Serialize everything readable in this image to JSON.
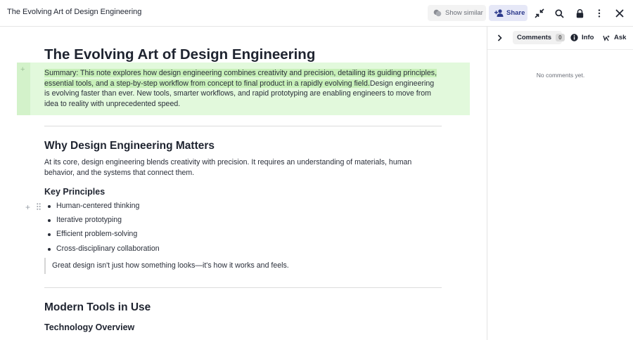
{
  "topbar": {
    "doc_title": "The Evolving Art of Design Engineering",
    "show_similar_label": "Show similar",
    "share_label": "Share"
  },
  "side_panel": {
    "comments_label": "Comments",
    "comments_count": "0",
    "info_label": "Info",
    "ask_label": "Ask",
    "empty_text": "No comments yet."
  },
  "document": {
    "title": "The Evolving Art of Design Engineering",
    "summary_highlighted": "Summary: This note explores how design engineering combines creativity and precision, detailing its guiding principles, essential tools, and a step-by-step workflow from concept to final product in a rapidly evolving field.",
    "summary_rest": "Design engineering is evolving faster than ever. New tools, smarter workflows, and rapid prototyping are enabling engineers to move from idea to reality with unprecedented speed.",
    "section1_heading": "Why Design Engineering Matters",
    "section1_paragraph": "At its core, design engineering blends creativity with precision. It requires an understanding of materials, human behavior, and the systems that connect them.",
    "principles_heading": "Key Principles",
    "principles": [
      "Human-centered thinking",
      "Iterative prototyping",
      "Efficient problem-solving",
      "Cross-disciplinary collaboration"
    ],
    "quote": "Great design isn't just how something looks—it's how it works and feels.",
    "section2_heading": "Modern Tools in Use",
    "tech_heading": "Technology Overview"
  },
  "colors": {
    "highlight": "#c8f0b9",
    "summary_block": "#e2f9dc",
    "share_bg": "#e6e8f7"
  }
}
